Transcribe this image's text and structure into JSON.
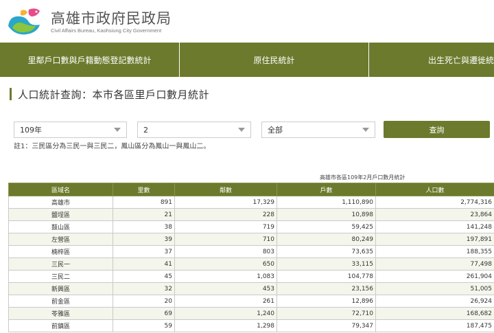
{
  "header": {
    "title": "高雄市政府民政局",
    "subtitle": "Civil Affairs Bureau, Kaohsiung City Government"
  },
  "nav": {
    "items": [
      {
        "label": "里鄰戶口數與戶籍動態登記數統計"
      },
      {
        "label": "原住民統計"
      },
      {
        "label": "出生死亡與遷徙統計"
      }
    ]
  },
  "page": {
    "title": "人口統計查詢：本市各區里戶口數月統計"
  },
  "filters": {
    "year": "109年",
    "month": "2",
    "district": "全部",
    "query_label": "查詢"
  },
  "note": "註1：三民區分為三民一與三民二，鳳山區分為鳳山一與鳳山二。",
  "table": {
    "caption": "高雄市各區109年2月戶口數月統計",
    "headers": [
      "區域名",
      "里數",
      "鄰數",
      "戶數",
      "人口數"
    ],
    "rows": [
      [
        "高雄市",
        "891",
        "17,329",
        "1,110,890",
        "2,774,316"
      ],
      [
        "鹽埕區",
        "21",
        "228",
        "10,898",
        "23,864"
      ],
      [
        "鼓山區",
        "38",
        "719",
        "59,425",
        "141,248"
      ],
      [
        "左營區",
        "39",
        "710",
        "80,249",
        "197,891"
      ],
      [
        "楠梓區",
        "37",
        "803",
        "73,635",
        "188,355"
      ],
      [
        "三民一",
        "41",
        "650",
        "33,115",
        "77,498"
      ],
      [
        "三民二",
        "45",
        "1,083",
        "104,778",
        "261,904"
      ],
      [
        "新興區",
        "32",
        "453",
        "23,156",
        "51,005"
      ],
      [
        "前金區",
        "20",
        "261",
        "12,896",
        "26,924"
      ],
      [
        "苓雅區",
        "69",
        "1,240",
        "72,710",
        "168,682"
      ],
      [
        "前鎮區",
        "59",
        "1,298",
        "79,347",
        "187,475"
      ]
    ]
  },
  "colors": {
    "accent": "#6b7a2c"
  }
}
